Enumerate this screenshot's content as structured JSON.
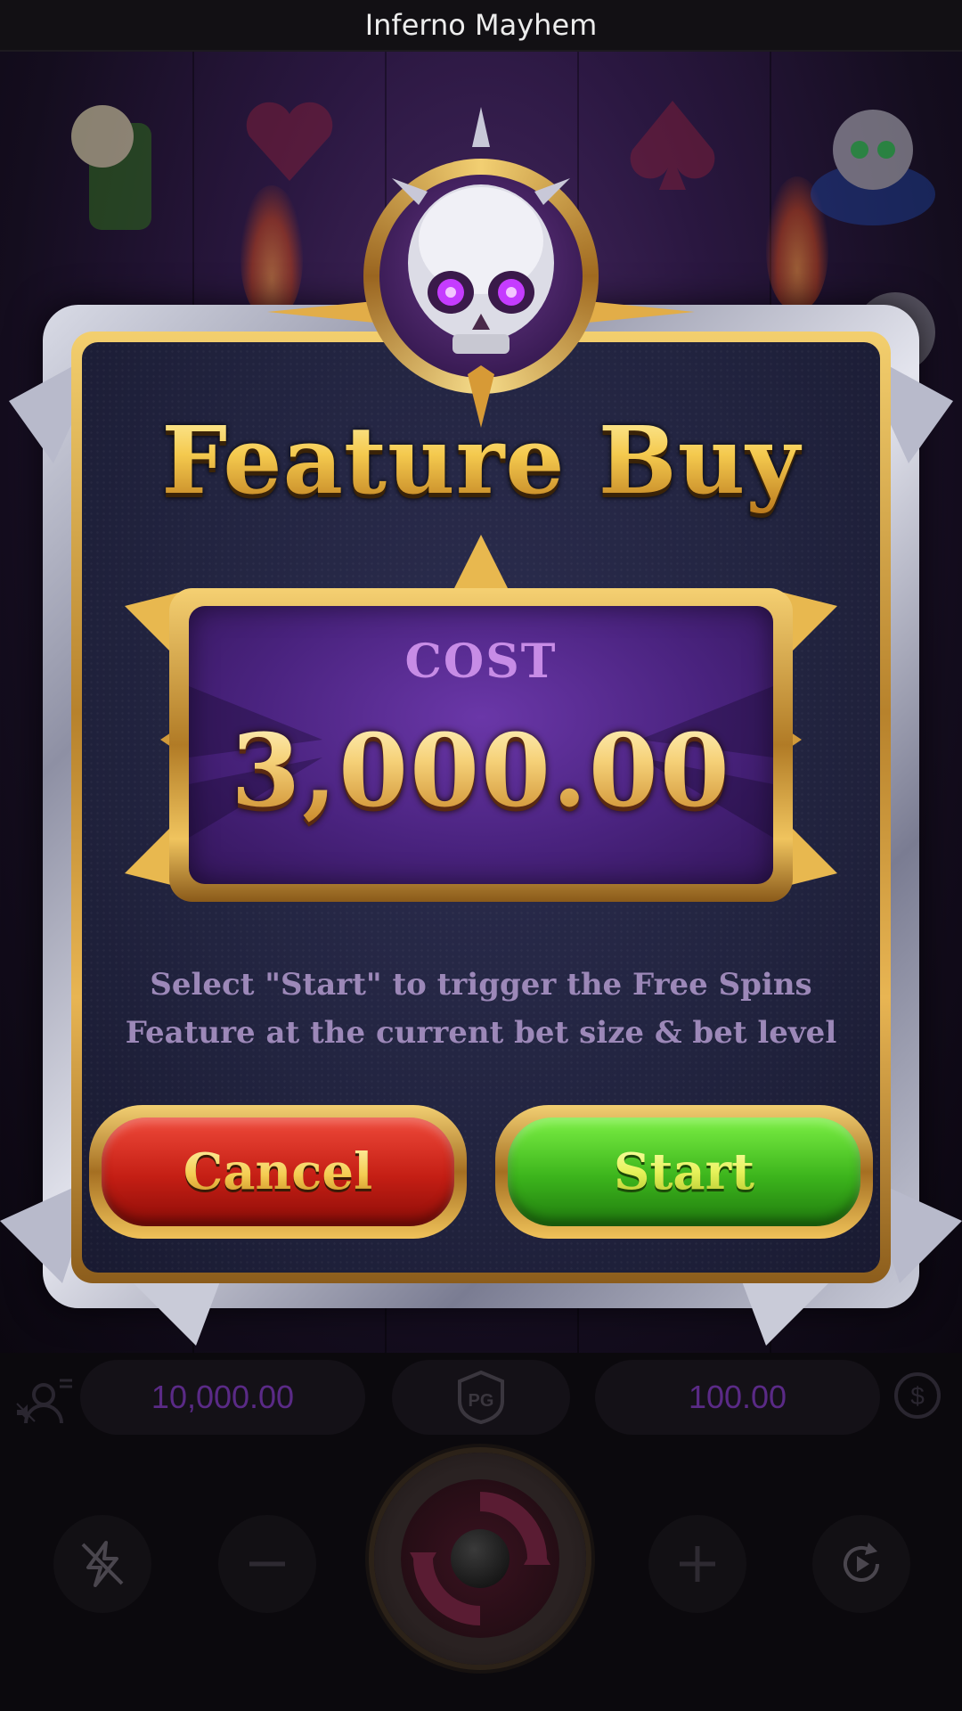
{
  "window": {
    "title": "Inferno Mayhem"
  },
  "modal": {
    "title": "Feature Buy",
    "cost_label": "COST",
    "cost_value": "3,000.00",
    "description_line1": "Select \"Start\" to trigger the Free Spins",
    "description_line2": "Feature at the current bet size & bet level",
    "cancel_label": "Cancel",
    "start_label": "Start"
  },
  "hud": {
    "balance": "10,000.00",
    "bet": "100.00",
    "logo": "PG"
  },
  "colors": {
    "gold": "#f4c94e",
    "cost_purple": "#4a237f",
    "cancel_red": "#c41e14",
    "start_green": "#3cb41c",
    "hud_value": "#5a2a86"
  },
  "icons": [
    "skull-emblem-icon",
    "user-menu-icon",
    "sound-off-icon",
    "pg-logo-icon",
    "dollar-coin-icon",
    "turbo-icon",
    "minus-icon",
    "spin-icon",
    "plus-icon",
    "autoplay-icon"
  ]
}
